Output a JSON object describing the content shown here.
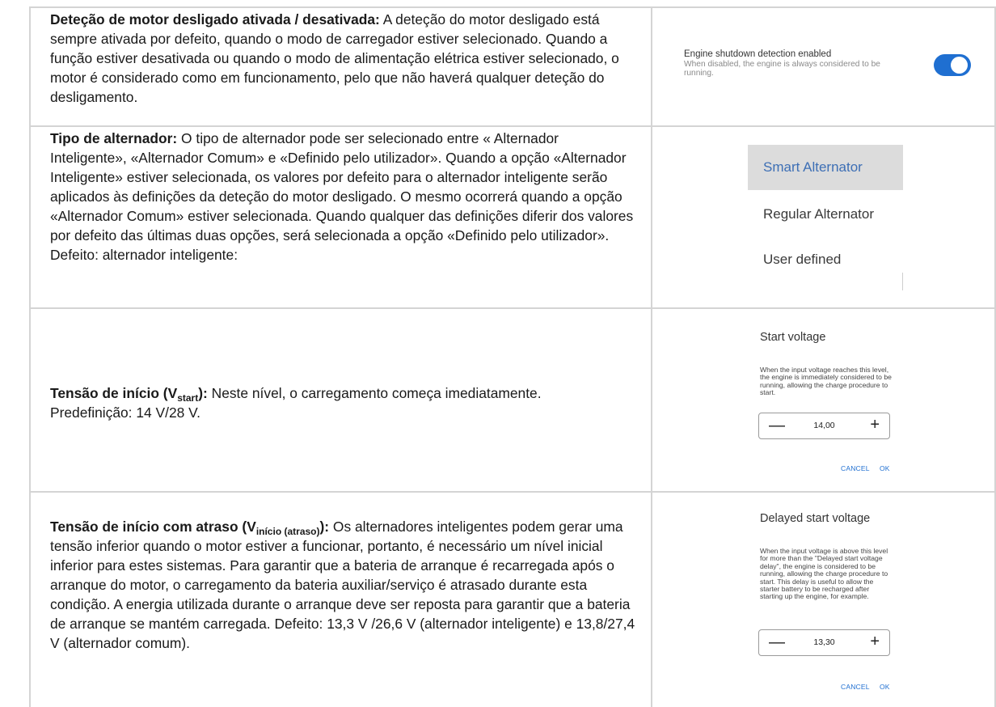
{
  "rows": [
    {
      "term": "Deteção de motor desligado ativada / desativada:",
      "text": " A deteção do motor desligado está sempre ativada por defeito, quando o modo de carregador estiver selecionado. Quando a função estiver desativada ou quando o modo de alimentação elétrica estiver selecionado, o motor é considerado como em funcionamento, pelo que não haverá qualquer deteção do desligamento."
    },
    {
      "term": "Tipo de alternador:",
      "text": " O tipo de alternador pode ser selecionado entre « Alternador Inteligente», «Alternador Comum» e «Definido pelo utilizador». Quando a opção «Alternador Inteligente» estiver selecionada, os valores por defeito para o alternador inteligente serão aplicados às definições da deteção do motor desligado. O mesmo ocorrerá quando a opção «Alternador Comum» estiver selecionada. Quando qualquer das definições diferir dos valores por defeito das últimas duas opções, será selecionada a opção «Definido pelo utilizador». Defeito: alternador inteligente:"
    },
    {
      "term_a": "Tensão de início (V",
      "term_sub": "start",
      "term_b": "):",
      "line1": " Neste nível, o carregamento começa imediatamente.",
      "line2": "Predefinição: 14 V/28 V."
    },
    {
      "term_a": "Tensão de início com atraso (V",
      "term_sub": "início (atraso)",
      "term_b": "):",
      "text": " Os alternadores inteligentes podem gerar uma tensão inferior quando o motor estiver a funcionar, portanto, é necessário um nível inicial inferior para estes sistemas. Para garantir que a bateria de arranque é recarregada após o arranque do motor, o carregamento da bateria auxiliar/serviço é atrasado durante esta condição. A energia utilizada durante o arranque deve ser reposta para garantir que a bateria de arranque se mantém carregada. Defeito: 13,3 V /26,6 V (alternador inteligente) e 13,8/27,4 V (alternador comum)."
    }
  ],
  "engine_toggle": {
    "title": "Engine shutdown detection enabled",
    "description": "When disabled, the engine is always considered to be running.",
    "enabled": true,
    "color": "#1f6fd1"
  },
  "alternator_menu": {
    "items": [
      "Smart Alternator",
      "Regular Alternator",
      "User defined"
    ],
    "selected": "Smart Alternator"
  },
  "start_voltage_dialog": {
    "title": "Start voltage",
    "description": "When the input voltage reaches this level, the engine is immediately considered to be running, allowing the charge procedure to start.",
    "value": "14,00",
    "cancel": "CANCEL",
    "ok": "OK"
  },
  "delayed_start_dialog": {
    "title": "Delayed start voltage",
    "description": "When the input voltage is above this level for more than the \"Delayed start voltage delay\", the engine is considered to be running, allowing the charge procedure to start. This delay is useful to allow the starter battery to be recharged after starting up the engine, for example.",
    "value": "13,30",
    "cancel": "CANCEL",
    "ok": "OK"
  }
}
